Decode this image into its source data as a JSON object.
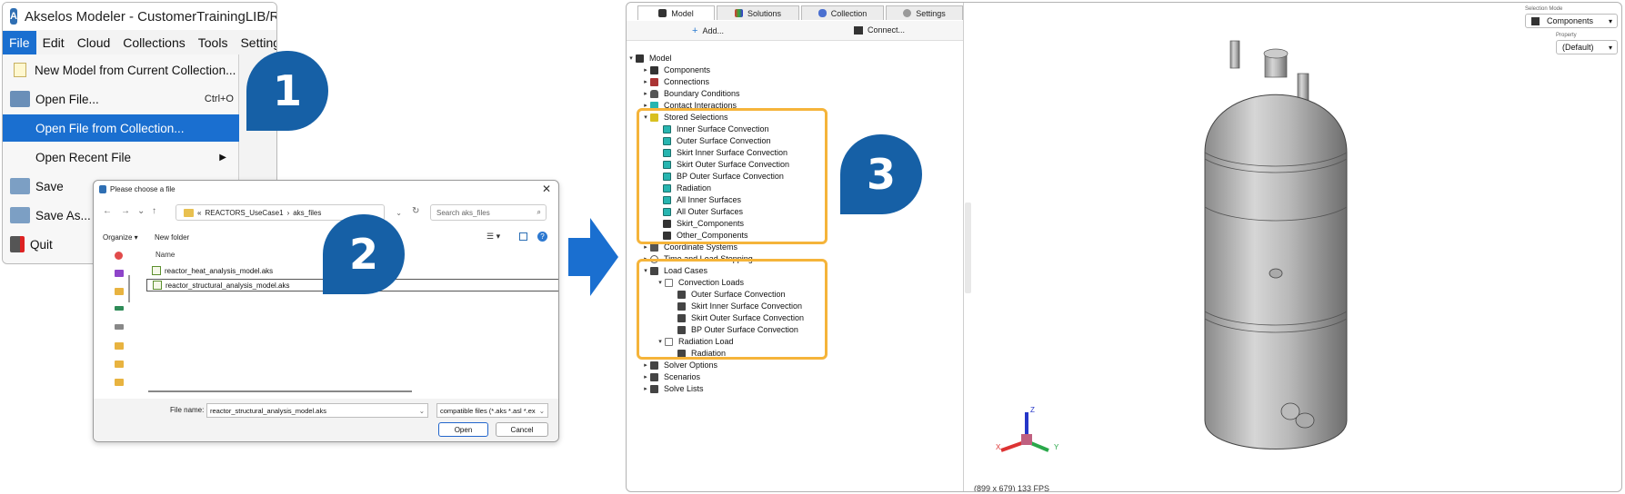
{
  "panel1": {
    "title": "Akselos Modeler - CustomerTrainingLIB/REAC",
    "menu": [
      "File",
      "Edit",
      "Cloud",
      "Collections",
      "Tools",
      "Settings"
    ],
    "items": [
      {
        "label": "New Model from Current Collection...",
        "shortcut": ""
      },
      {
        "label": "Open File...",
        "shortcut": "Ctrl+O"
      },
      {
        "label": "Open File from Collection...",
        "shortcut": ""
      },
      {
        "label": "Open Recent File",
        "shortcut": ""
      },
      {
        "label": "Save",
        "shortcut": ""
      },
      {
        "label": "Save As...",
        "shortcut": ""
      },
      {
        "label": "Quit",
        "shortcut": ""
      }
    ],
    "badge": "1"
  },
  "panel2": {
    "title": "Please choose a file",
    "path": [
      "«",
      "REACTORS_UseCase1",
      "›",
      "aks_files"
    ],
    "search_placeholder": "Search aks_files",
    "organize": "Organize ▾",
    "new_folder": "New folder",
    "column_name": "Name",
    "files": [
      "reactor_heat_analysis_model.aks",
      "reactor_structural_analysis_model.aks"
    ],
    "filename_label": "File name:",
    "filename_value": "reactor_structural_analysis_model.aks",
    "filetype_value": "compatible files (*.aks *.asl *.ex",
    "open_label": "Open",
    "cancel_label": "Cancel",
    "badge": "2"
  },
  "panel3": {
    "tabs": [
      "Model",
      "Solutions",
      "Collection",
      "Settings"
    ],
    "add_label": "Add...",
    "connect_label": "Connect...",
    "tree": {
      "model": "Model",
      "components": "Components",
      "connections": "Connections",
      "boundary": "Boundary Conditions",
      "contact": "Contact Interactions",
      "stored": "Stored Selections",
      "stored_items": [
        "Inner Surface Convection",
        "Outer Surface Convection",
        "Skirt Inner Surface Convection",
        "Skirt Outer Surface Convection",
        "BP Outer Surface Convection",
        "Radiation",
        "All Inner Surfaces",
        "All Outer Surfaces",
        "Skirt_Components",
        "Other_Components"
      ],
      "coord": "Coordinate Systems",
      "time": "Time and Load Stepping",
      "load_cases": "Load Cases",
      "conv_loads": "Convection Loads",
      "conv_items": [
        "Outer Surface Convection",
        "Skirt Inner Surface Convection",
        "Skirt Outer Surface Convection",
        "BP Outer Surface Convection"
      ],
      "rad_load": "Radiation Load",
      "rad_items": [
        "Radiation"
      ],
      "solver": "Solver Options",
      "scenarios": "Scenarios",
      "solve_lists": "Solve Lists"
    },
    "selection_mode_label": "Selection Mode",
    "selection_mode_value": "Components",
    "property_label": "Property",
    "property_value": "(Default)",
    "axes": {
      "x": "X",
      "y": "Y",
      "z": "Z"
    },
    "status": "(899 x 679) 133 FPS",
    "badge": "3"
  },
  "colors": {
    "accent": "#1a6fd0",
    "badge": "#1660a6",
    "highlight": "#f5b43a",
    "teal": "#27b5b0"
  }
}
